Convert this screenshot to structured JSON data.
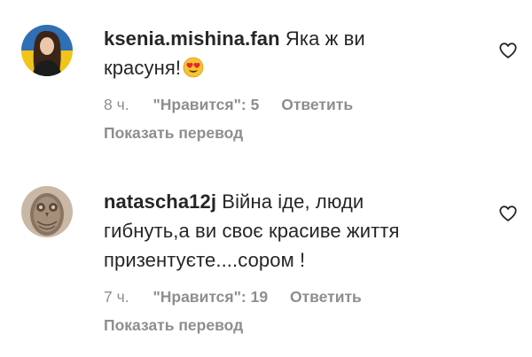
{
  "comments": [
    {
      "username": "ksenia.mishina.fan",
      "text_line1": "Яка ж ви",
      "text_line2": "красуня!",
      "emoji": "heart-eyes-emoji",
      "time": "8 ч.",
      "likes": "\"Нравится\": 5",
      "reply": "Ответить",
      "translate": "Показать перевод",
      "avatar": "avatar-photo-ukrainian-flag"
    },
    {
      "username": "natascha12j",
      "text_line1": "Війна іде, люди",
      "text_line2": "гибнуть,а ви своє красиве життя",
      "text_line3": "призентуєте....сором !",
      "time": "7 ч.",
      "likes": "\"Нравится\": 19",
      "reply": "Ответить",
      "translate": "Показать перевод",
      "avatar": "avatar-photo-owl"
    }
  ],
  "icons": {
    "like": "heart-outline-icon"
  },
  "colors": {
    "text": "#262626",
    "secondary": "#8e8e8e",
    "background": "#ffffff"
  }
}
